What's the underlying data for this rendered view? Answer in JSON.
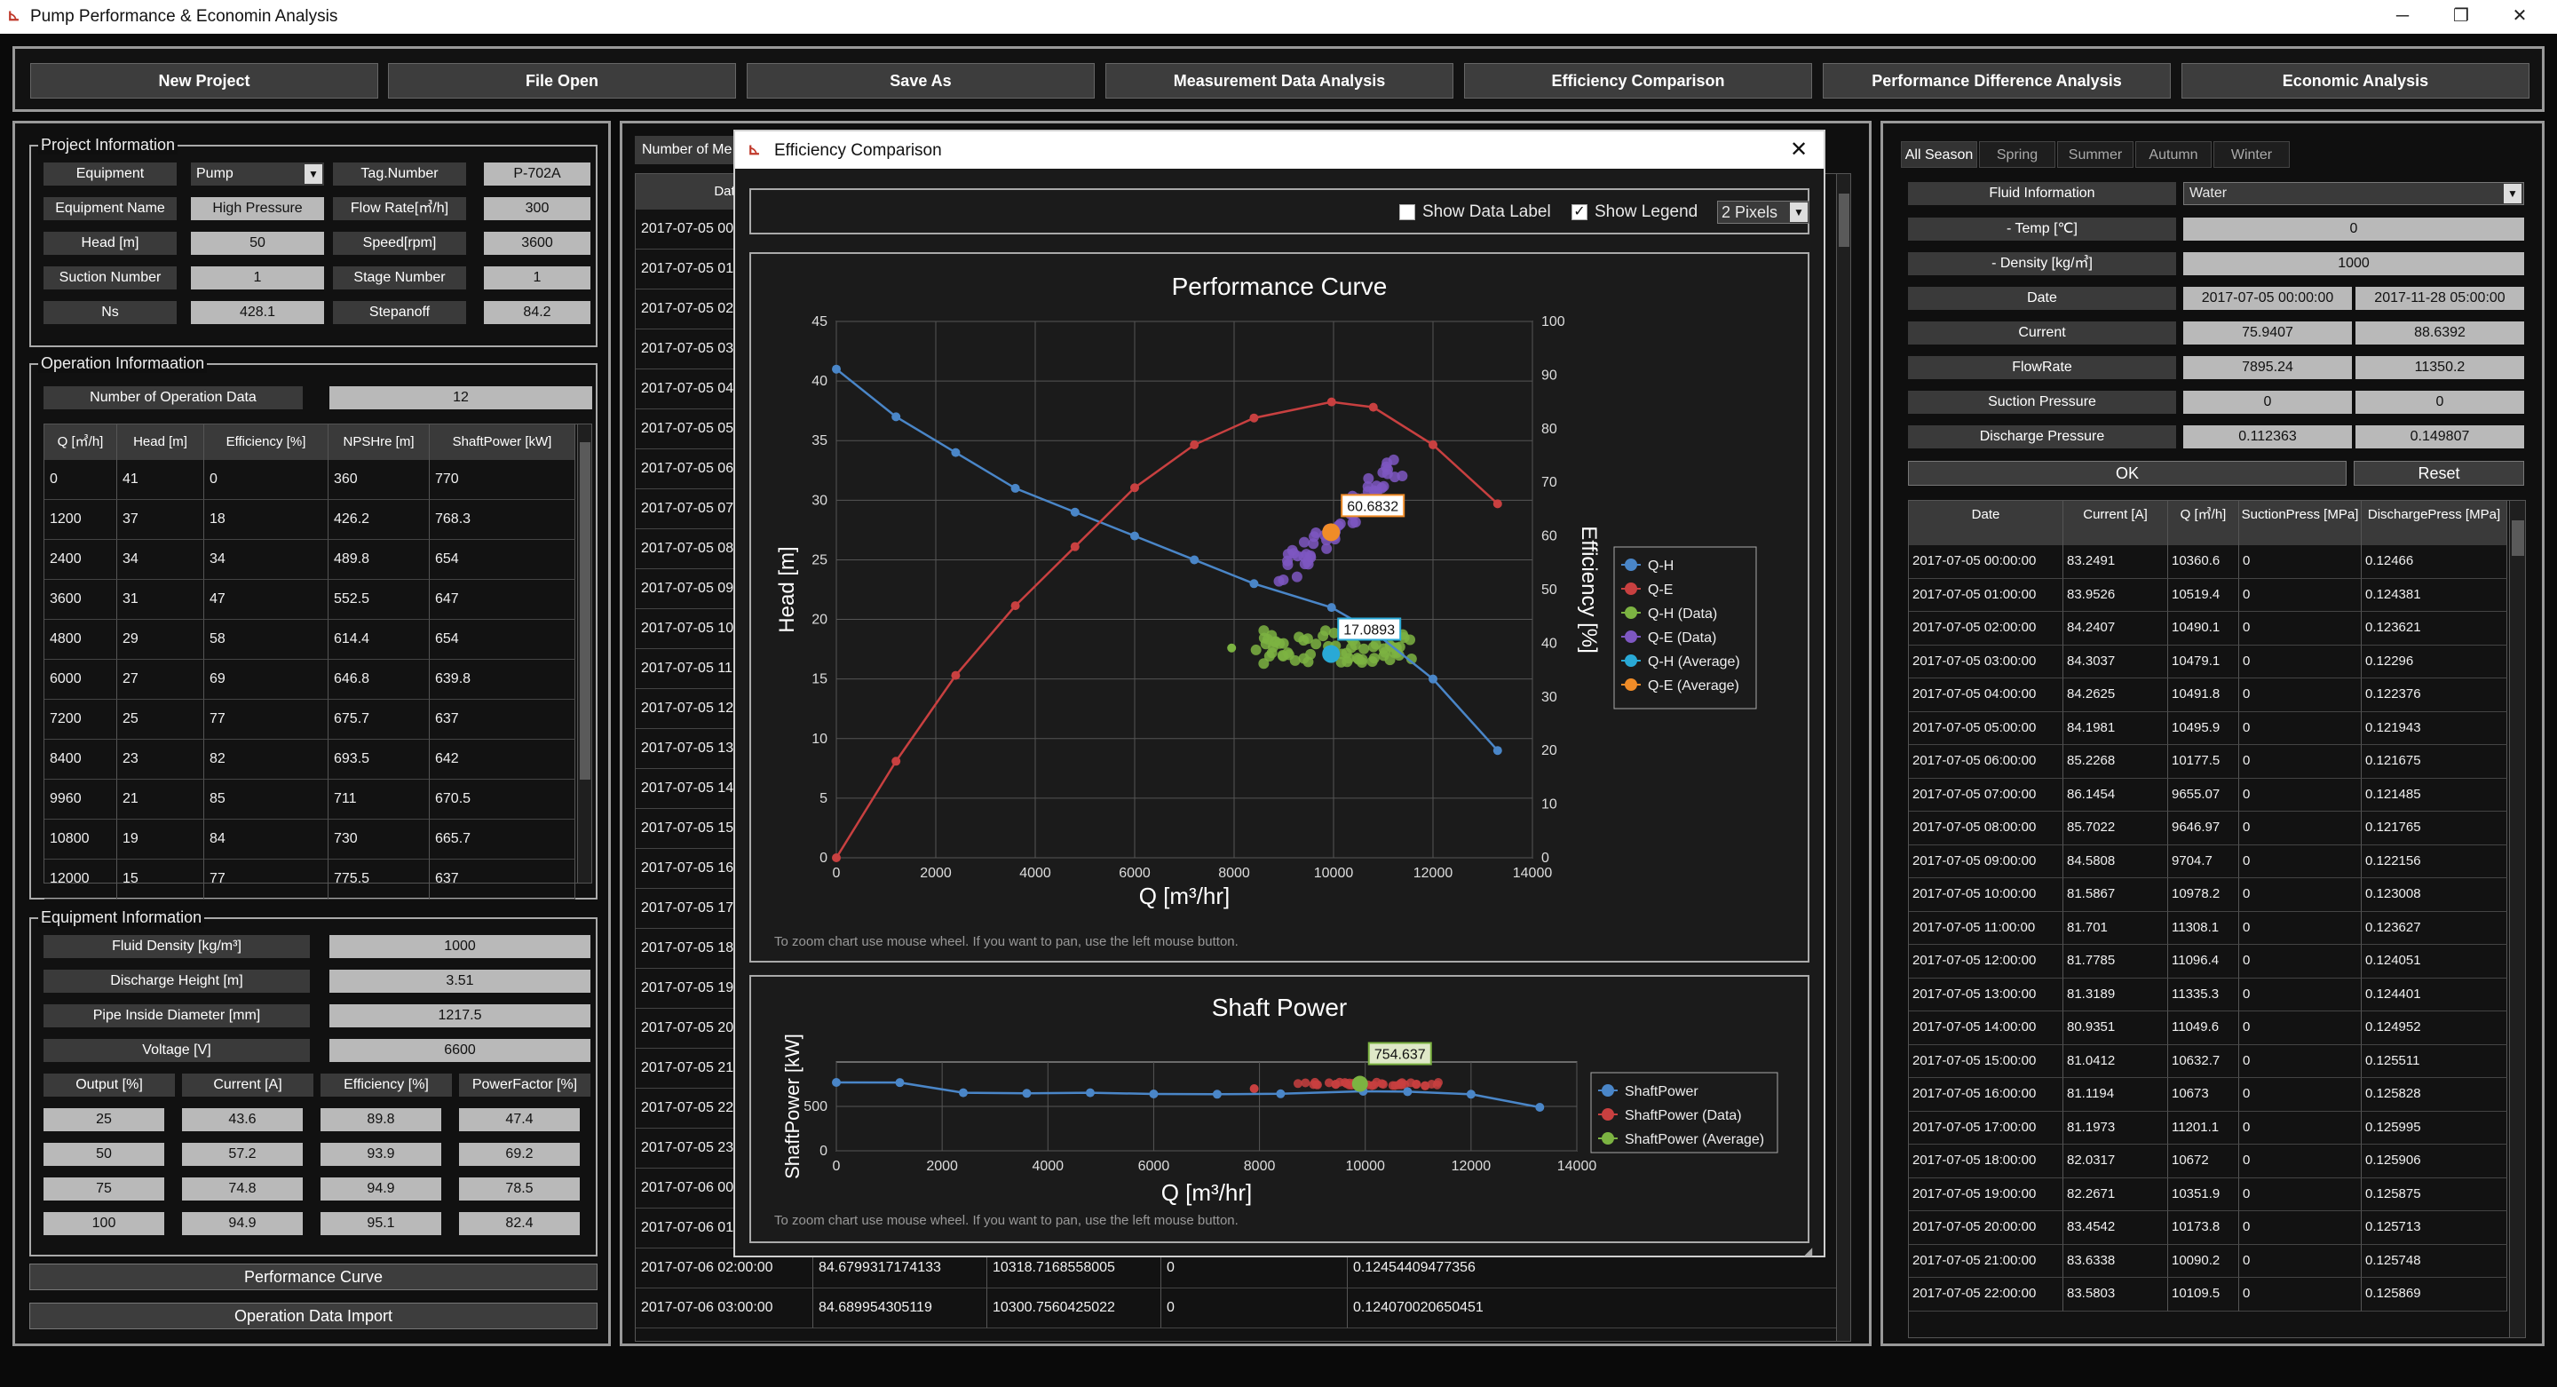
{
  "window": {
    "title": "Pump Performance & Economin Analysis",
    "minimize": "─",
    "restore": "❐",
    "close": "✕"
  },
  "toolbar": {
    "buttons": [
      "New Project",
      "File Open",
      "Save As",
      "Measurement Data Analysis",
      "Efficiency Comparison",
      "Performance Difference Analysis",
      "Economic Analysis"
    ]
  },
  "project_info": {
    "title": "Project Information",
    "rows": [
      [
        "Equipment",
        "Pump",
        "Tag.Number",
        "P-702A"
      ],
      [
        "Equipment Name",
        "High Pressure",
        "Flow Rate[㎥/h]",
        "300"
      ],
      [
        "Head [m]",
        "50",
        "Speed[rpm]",
        "3600"
      ],
      [
        "Suction Number",
        "1",
        "Stage Number",
        "1"
      ],
      [
        "Ns",
        "428.1",
        "Stepanoff",
        "84.2"
      ]
    ]
  },
  "operation_info": {
    "title": "Operation Informaation",
    "count_label": "Number of Operation Data",
    "count_value": "12",
    "headers": [
      "Q [㎥/h]",
      "Head [m]",
      "Efficiency [%]",
      "NPSHre [m]",
      "ShaftPower [kW]"
    ],
    "rows": [
      [
        "0",
        "41",
        "0",
        "360",
        "770"
      ],
      [
        "1200",
        "37",
        "18",
        "426.2",
        "768.3"
      ],
      [
        "2400",
        "34",
        "34",
        "489.8",
        "654"
      ],
      [
        "3600",
        "31",
        "47",
        "552.5",
        "647"
      ],
      [
        "4800",
        "29",
        "58",
        "614.4",
        "654"
      ],
      [
        "6000",
        "27",
        "69",
        "646.8",
        "639.8"
      ],
      [
        "7200",
        "25",
        "77",
        "675.7",
        "637"
      ],
      [
        "8400",
        "23",
        "82",
        "693.5",
        "642"
      ],
      [
        "9960",
        "21",
        "85",
        "711",
        "670.5"
      ],
      [
        "10800",
        "19",
        "84",
        "730",
        "665.7"
      ],
      [
        "12000",
        "15",
        "77",
        "775.5",
        "637"
      ]
    ]
  },
  "equipment_info": {
    "title": "Equipment Information",
    "rows": [
      [
        "Fluid Density [kg/m³]",
        "1000"
      ],
      [
        "Discharge Height [m]",
        "3.51"
      ],
      [
        "Pipe Inside Diameter [mm]",
        "1217.5"
      ],
      [
        "Voltage [V]",
        "6600"
      ]
    ],
    "headers": [
      "Output [%]",
      "Current [A]",
      "Efficiency [%]",
      "PowerFactor [%]"
    ],
    "table": [
      [
        "25",
        "43.6",
        "89.8",
        "47.4"
      ],
      [
        "50",
        "57.2",
        "93.9",
        "69.2"
      ],
      [
        "75",
        "74.8",
        "94.9",
        "78.5"
      ],
      [
        "100",
        "94.9",
        "95.1",
        "82.4"
      ]
    ],
    "btn_curve": "Performance Curve",
    "btn_import": "Operation Data Import"
  },
  "middle": {
    "number_label": "Number of Me",
    "date_header": "Dat",
    "dates": [
      "2017-07-05 00",
      "2017-07-05 01",
      "2017-07-05 02",
      "2017-07-05 03",
      "2017-07-05 04",
      "2017-07-05 05",
      "2017-07-05 06",
      "2017-07-05 07",
      "2017-07-05 08",
      "2017-07-05 09",
      "2017-07-05 10",
      "2017-07-05 11",
      "2017-07-05 12",
      "2017-07-05 13",
      "2017-07-05 14",
      "2017-07-05 15",
      "2017-07-05 16",
      "2017-07-05 17",
      "2017-07-05 18",
      "2017-07-05 19",
      "2017-07-05 20",
      "2017-07-05 21",
      "2017-07-05 22",
      "2017-07-05 23",
      "2017-07-06 00",
      "2017-07-06 01"
    ],
    "bottom_rows": [
      [
        "2017-07-06 02:00:00",
        "84.6799317174133",
        "10318.7168558005",
        "0",
        "0.12454409477356"
      ],
      [
        "2017-07-06 03:00:00",
        "84.689954305119",
        "10300.7560425022",
        "0",
        "0.124070020650451"
      ]
    ]
  },
  "dialog": {
    "title": "Efficiency Comparison",
    "show_data_label": "Show Data Label",
    "show_legend": "Show Legend",
    "pixels": "2 Pixels",
    "hint": "To zoom chart use mouse wheel. If you want to pan, use the left mouse button.",
    "close": "✕"
  },
  "right": {
    "tabs": [
      "All Season",
      "Spring",
      "Summer",
      "Autumn",
      "Winter"
    ],
    "fluid_label": "Fluid Information",
    "fluid_value": "Water",
    "rows": [
      [
        "- Temp [℃]",
        "0",
        ""
      ],
      [
        "- Density [kg/㎥]",
        "1000",
        ""
      ],
      [
        "Date",
        "2017-07-05 00:00:00",
        "2017-11-28 05:00:00"
      ],
      [
        "Current",
        "75.9407",
        "88.6392"
      ],
      [
        "FlowRate",
        "7895.24",
        "11350.2"
      ],
      [
        "Suction Pressure",
        "0",
        "0"
      ],
      [
        "Discharge Pressure",
        "0.112363",
        "0.149807"
      ]
    ],
    "ok": "OK",
    "reset": "Reset",
    "headers": [
      "Date",
      "Current [A]",
      "Q [㎥/h]",
      "SuctionPress [MPa]",
      "DischargePress [MPa]"
    ],
    "table": [
      [
        "2017-07-05 00:00:00",
        "83.2491",
        "10360.6",
        "0",
        "0.12466"
      ],
      [
        "2017-07-05 01:00:00",
        "83.9526",
        "10519.4",
        "0",
        "0.124381"
      ],
      [
        "2017-07-05 02:00:00",
        "84.2407",
        "10490.1",
        "0",
        "0.123621"
      ],
      [
        "2017-07-05 03:00:00",
        "84.3037",
        "10479.1",
        "0",
        "0.12296"
      ],
      [
        "2017-07-05 04:00:00",
        "84.2625",
        "10491.8",
        "0",
        "0.122376"
      ],
      [
        "2017-07-05 05:00:00",
        "84.1981",
        "10495.9",
        "0",
        "0.121943"
      ],
      [
        "2017-07-05 06:00:00",
        "85.2268",
        "10177.5",
        "0",
        "0.121675"
      ],
      [
        "2017-07-05 07:00:00",
        "86.1454",
        "9655.07",
        "0",
        "0.121485"
      ],
      [
        "2017-07-05 08:00:00",
        "85.7022",
        "9646.97",
        "0",
        "0.121765"
      ],
      [
        "2017-07-05 09:00:00",
        "84.5808",
        "9704.7",
        "0",
        "0.122156"
      ],
      [
        "2017-07-05 10:00:00",
        "81.5867",
        "10978.2",
        "0",
        "0.123008"
      ],
      [
        "2017-07-05 11:00:00",
        "81.701",
        "11308.1",
        "0",
        "0.123627"
      ],
      [
        "2017-07-05 12:00:00",
        "81.7785",
        "11096.4",
        "0",
        "0.124051"
      ],
      [
        "2017-07-05 13:00:00",
        "81.3189",
        "11335.3",
        "0",
        "0.124401"
      ],
      [
        "2017-07-05 14:00:00",
        "80.9351",
        "11049.6",
        "0",
        "0.124952"
      ],
      [
        "2017-07-05 15:00:00",
        "81.0412",
        "10632.7",
        "0",
        "0.125511"
      ],
      [
        "2017-07-05 16:00:00",
        "81.1194",
        "10673",
        "0",
        "0.125828"
      ],
      [
        "2017-07-05 17:00:00",
        "81.1973",
        "11201.1",
        "0",
        "0.125995"
      ],
      [
        "2017-07-05 18:00:00",
        "82.0317",
        "10672",
        "0",
        "0.125906"
      ],
      [
        "2017-07-05 19:00:00",
        "82.2671",
        "10351.9",
        "0",
        "0.125875"
      ],
      [
        "2017-07-05 20:00:00",
        "83.4542",
        "10173.8",
        "0",
        "0.125713"
      ],
      [
        "2017-07-05 21:00:00",
        "83.6338",
        "10090.2",
        "0",
        "0.125748"
      ],
      [
        "2017-07-05 22:00:00",
        "83.5803",
        "10109.5",
        "0",
        "0.125869"
      ]
    ]
  },
  "chart_data": [
    {
      "type": "line",
      "title": "Performance Curve",
      "xlabel": "Q [m³/hr]",
      "ylabel": "Head [m]",
      "y2label": "Efficiency [%]",
      "xlim": [
        0,
        14000
      ],
      "ylim": [
        0,
        45
      ],
      "y2lim": [
        0,
        100
      ],
      "xticks": [
        "0",
        "2000",
        "4000",
        "6000",
        "8000",
        "10000",
        "12000",
        "14000"
      ],
      "yticks": [
        "0",
        "5",
        "10",
        "15",
        "20",
        "25",
        "30",
        "35",
        "40",
        "45"
      ],
      "y2ticks": [
        "0",
        "10",
        "20",
        "30",
        "40",
        "50",
        "60",
        "70",
        "80",
        "90",
        "100"
      ],
      "legend": "right",
      "grid": true,
      "series": [
        {
          "name": "Q-H",
          "color": "#4a86c8",
          "x": [
            0,
            1200,
            2400,
            3600,
            4800,
            6000,
            7200,
            8400,
            9960,
            10800,
            12000,
            13300
          ],
          "y": [
            41,
            37,
            34,
            31,
            29,
            27,
            25,
            23,
            21,
            19,
            15,
            9
          ]
        },
        {
          "name": "Q-E",
          "color": "#c84040",
          "axis": "y2",
          "x": [
            0,
            1200,
            2400,
            3600,
            4800,
            6000,
            7200,
            8400,
            9960,
            10800,
            12000,
            13300
          ],
          "y": [
            0,
            18,
            34,
            47,
            58,
            69,
            77,
            82,
            85,
            84,
            77,
            66
          ]
        },
        {
          "name": "Q-H (Data)",
          "color": "#7cb342"
        },
        {
          "name": "Q-E (Data)",
          "color": "#7e57c2"
        },
        {
          "name": "Q-H (Average)",
          "color": "#29a9d6",
          "x": [
            9950
          ],
          "y": [
            17.1
          ]
        },
        {
          "name": "Q-E (Average)",
          "color": "#f08c28",
          "axis": "y2",
          "x": [
            9950
          ],
          "y": [
            60.7
          ]
        }
      ],
      "labels": [
        "60.6832",
        "17.0893"
      ]
    },
    {
      "type": "line",
      "title": "Shaft Power",
      "xlabel": "Q [m³/hr]",
      "ylabel": "ShaftPower [kW]",
      "xlim": [
        0,
        14000
      ],
      "ylim": [
        0,
        1000
      ],
      "xticks": [
        "0",
        "2000",
        "4000",
        "6000",
        "8000",
        "10000",
        "12000",
        "14000"
      ],
      "yticks": [
        "0",
        "500"
      ],
      "legend": "right",
      "grid": true,
      "series": [
        {
          "name": "ShaftPower",
          "color": "#4a86c8",
          "x": [
            0,
            1200,
            2400,
            3600,
            4800,
            6000,
            7200,
            8400,
            9960,
            10800,
            12000,
            13300
          ],
          "y": [
            770,
            768.3,
            654,
            647,
            654,
            639.8,
            637,
            642,
            670.5,
            665.7,
            637,
            490
          ]
        },
        {
          "name": "ShaftPower (Data)",
          "color": "#c84040"
        },
        {
          "name": "ShaftPower (Average)",
          "color": "#7cb342",
          "x": [
            9900
          ],
          "y": [
            754.6
          ]
        }
      ],
      "labels": [
        "754.637"
      ]
    }
  ]
}
